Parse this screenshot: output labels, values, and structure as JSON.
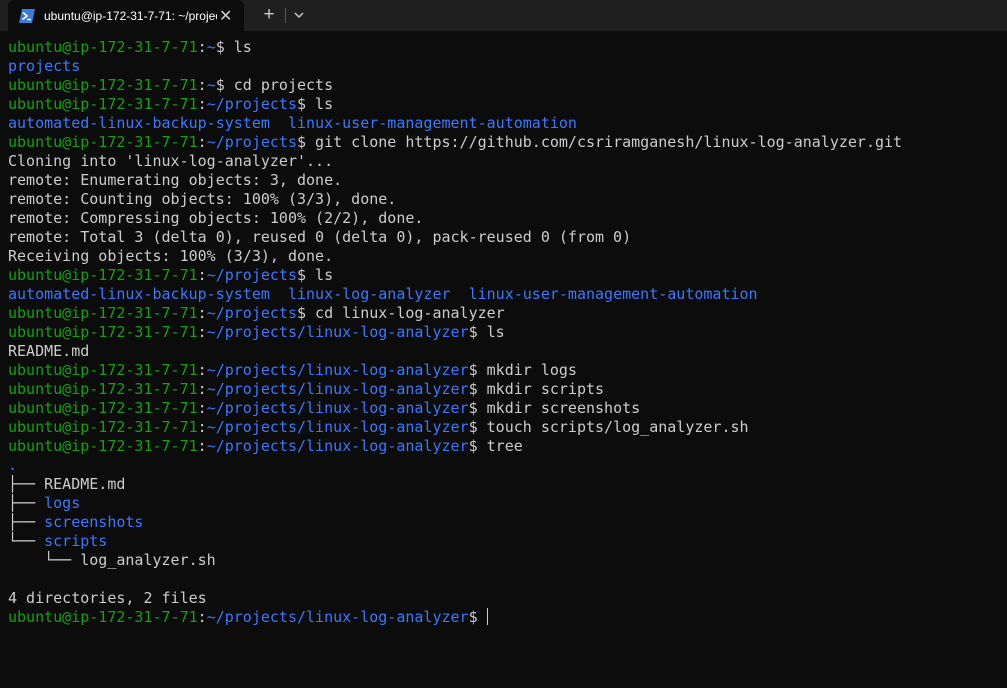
{
  "window": {
    "tab_title": "ubuntu@ip-172-31-7-71: ~/projects/linux-log-analyzer",
    "tab_icon": "powershell-terminal-icon",
    "close_glyph": "✕",
    "new_tab_glyph": "+"
  },
  "colors": {
    "background": "#0c0c0c",
    "user_host": "#13a10e",
    "path": "#3b78ff",
    "text": "#cccccc"
  },
  "terminal": {
    "user_host": "ubuntu@ip-172-31-7-71",
    "lines": [
      {
        "t": "prompt",
        "path": "~",
        "cmd": " ls"
      },
      {
        "t": "dirs",
        "items": [
          "projects"
        ]
      },
      {
        "t": "prompt",
        "path": "~",
        "cmd": " cd projects"
      },
      {
        "t": "prompt",
        "path": "~/projects",
        "cmd": " ls"
      },
      {
        "t": "dirs",
        "items": [
          "automated-linux-backup-system",
          "linux-user-management-automation"
        ]
      },
      {
        "t": "prompt",
        "path": "~/projects",
        "cmd": " git clone https://github.com/csriramganesh/linux-log-analyzer.git"
      },
      {
        "t": "out",
        "text": "Cloning into 'linux-log-analyzer'..."
      },
      {
        "t": "out",
        "text": "remote: Enumerating objects: 3, done."
      },
      {
        "t": "out",
        "text": "remote: Counting objects: 100% (3/3), done."
      },
      {
        "t": "out",
        "text": "remote: Compressing objects: 100% (2/2), done."
      },
      {
        "t": "out",
        "text": "remote: Total 3 (delta 0), reused 0 (delta 0), pack-reused 0 (from 0)"
      },
      {
        "t": "out",
        "text": "Receiving objects: 100% (3/3), done."
      },
      {
        "t": "prompt",
        "path": "~/projects",
        "cmd": " ls"
      },
      {
        "t": "dirs",
        "items": [
          "automated-linux-backup-system",
          "linux-log-analyzer",
          "linux-user-management-automation"
        ]
      },
      {
        "t": "prompt",
        "path": "~/projects",
        "cmd": " cd linux-log-analyzer"
      },
      {
        "t": "prompt",
        "path": "~/projects/linux-log-analyzer",
        "cmd": " ls"
      },
      {
        "t": "out",
        "text": "README.md"
      },
      {
        "t": "prompt",
        "path": "~/projects/linux-log-analyzer",
        "cmd": " mkdir logs"
      },
      {
        "t": "prompt",
        "path": "~/projects/linux-log-analyzer",
        "cmd": " mkdir scripts"
      },
      {
        "t": "prompt",
        "path": "~/projects/linux-log-analyzer",
        "cmd": " mkdir screenshots"
      },
      {
        "t": "prompt",
        "path": "~/projects/linux-log-analyzer",
        "cmd": " touch scripts/log_analyzer.sh"
      },
      {
        "t": "prompt",
        "path": "~/projects/linux-log-analyzer",
        "cmd": " tree"
      },
      {
        "t": "tree",
        "prefix": "",
        "name": ".",
        "dir": true
      },
      {
        "t": "tree",
        "prefix": "├── ",
        "name": "README.md",
        "dir": false
      },
      {
        "t": "tree",
        "prefix": "├── ",
        "name": "logs",
        "dir": true
      },
      {
        "t": "tree",
        "prefix": "├── ",
        "name": "screenshots",
        "dir": true
      },
      {
        "t": "tree",
        "prefix": "└── ",
        "name": "scripts",
        "dir": true
      },
      {
        "t": "tree",
        "prefix": "    └── ",
        "name": "log_analyzer.sh",
        "dir": false
      },
      {
        "t": "out",
        "text": ""
      },
      {
        "t": "out",
        "text": "4 directories, 2 files"
      },
      {
        "t": "prompt",
        "path": "~/projects/linux-log-analyzer",
        "cmd": " ",
        "cursor": true
      }
    ]
  }
}
